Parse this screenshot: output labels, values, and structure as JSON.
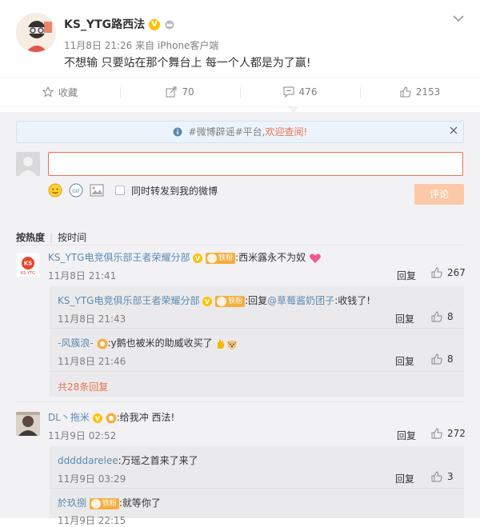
{
  "post": {
    "username": "KS_YTG路西法",
    "meta": "11月8日 21:26 来自 iPhone客户端",
    "content": "不想输  只要站在那个舞台上 每一个人都是为了赢!"
  },
  "actions": {
    "favorite": "收藏",
    "forward_count": "70",
    "comment_count": "476",
    "like_count": "2153"
  },
  "notice": {
    "prefix": "#微博辟谣#平台,",
    "link": "欢迎查阅!"
  },
  "composer": {
    "input_value": "",
    "sync_label": "同时转发到我的微博",
    "submit_label": "评论"
  },
  "sort": {
    "hot": "按热度",
    "time": "按时间"
  },
  "comments": [
    {
      "name": "KS_YTG电竞俱乐部王者荣耀分部",
      "badge": "铁粉",
      "text": ":西米露永不为奴",
      "time": "11月8日 21:41",
      "reply": "回复",
      "likes": "267",
      "subs": [
        {
          "name": "KS_YTG电竞俱乐部王者荣耀分部",
          "badge": "铁粉",
          "text": ":回复",
          "mention": "@草莓酱奶团子",
          "text2": ":收钱了!",
          "time": "11月8日 21:43",
          "reply": "回复",
          "likes": "8"
        },
        {
          "name": "-风簇浪-",
          "text": ":y鹅也被米的助威收买了",
          "time": "11月8日 21:46",
          "reply": "回复",
          "likes": "8"
        }
      ],
      "more": "共28条回复"
    },
    {
      "name": "DL丶拖米",
      "text": ":给我冲 西法!",
      "time": "11月9日 02:52",
      "reply": "回复",
      "likes": "272",
      "subs": [
        {
          "name": "dddddarelee",
          "text": ":万瑶之首来了来了",
          "time": "11月9日 03:29",
          "reply": "回复",
          "likes": "3"
        },
        {
          "name": "於玖捌",
          "badge": "铁粉",
          "text": ":就等你了",
          "time": "11月9日 22:15"
        }
      ]
    }
  ],
  "colors": {
    "accent": "#eb7350",
    "link": "#5c89b1",
    "panel": "#f2f2f5"
  }
}
